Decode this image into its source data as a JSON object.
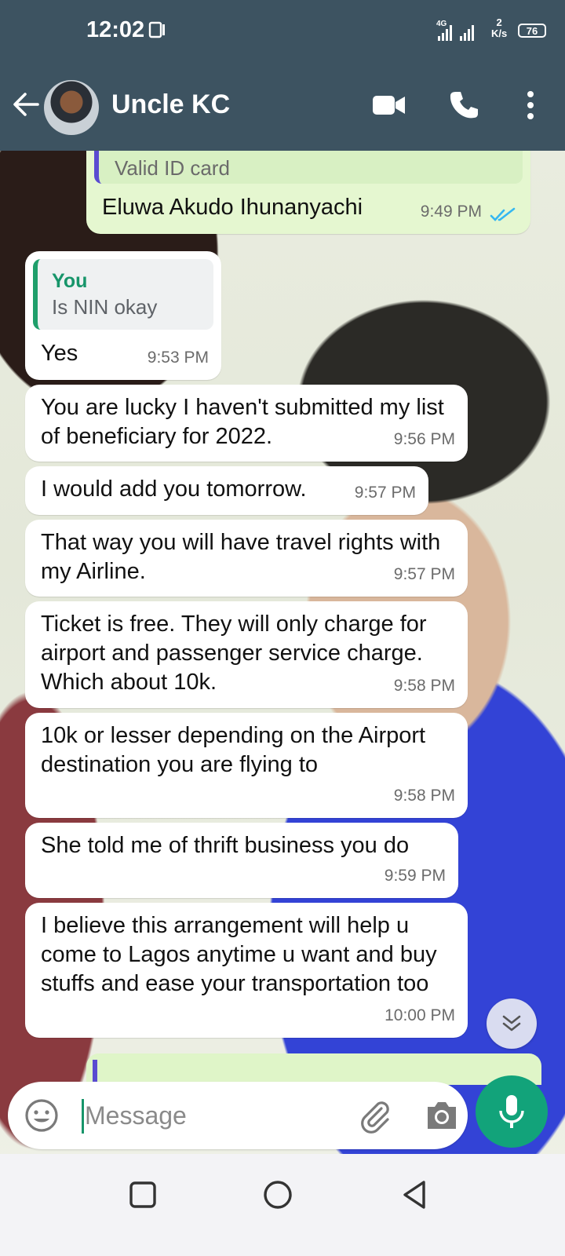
{
  "status_bar": {
    "time": "12:02",
    "network": "4G",
    "net_speed": "2",
    "net_speed_unit": "K/s",
    "battery": "76"
  },
  "header": {
    "contact_name": "Uncle KC",
    "icons": [
      "back-arrow-icon",
      "video-call-icon",
      "phone-icon",
      "more-vert-icon"
    ]
  },
  "messages": {
    "partial_top": {
      "quote_text": "Valid ID card",
      "text": "Eluwa Akudo Ihunanyachi",
      "time": "9:49 PM",
      "status": "read"
    },
    "reply_yes": {
      "quote_author": "You",
      "quote_text": "Is NIN okay",
      "text": "Yes",
      "time": "9:53 PM"
    },
    "m1": {
      "text": "You are lucky I haven't submitted my list of beneficiary for 2022.",
      "time": "9:56 PM"
    },
    "m2": {
      "text": "I would add you tomorrow.",
      "time": "9:57 PM"
    },
    "m3": {
      "text": "That way you will have travel rights with my Airline.",
      "time": "9:57 PM"
    },
    "m4": {
      "text": "Ticket is free. They will only charge for airport and passenger service charge. Which about 10k.",
      "time": "9:58 PM"
    },
    "m5": {
      "text": "10k or lesser depending on the Airport destination you are flying to",
      "time": "9:58 PM"
    },
    "m6": {
      "text": "She told me of thrift business you do",
      "time": "9:59 PM"
    },
    "m7": {
      "text": "I believe this arrangement will help u come to Lagos anytime u want and buy stuffs and ease your transportation too",
      "time": "10:00 PM"
    }
  },
  "composer": {
    "placeholder": "Message",
    "icons": [
      "emoji-icon",
      "attach-icon",
      "camera-icon",
      "mic-icon"
    ]
  },
  "colors": {
    "header": "#3d5361",
    "accent": "#12a37a",
    "outgoing_bubble": "#e5f7d0",
    "incoming_bubble": "#ffffff",
    "read_ticks": "#34b7f1"
  }
}
